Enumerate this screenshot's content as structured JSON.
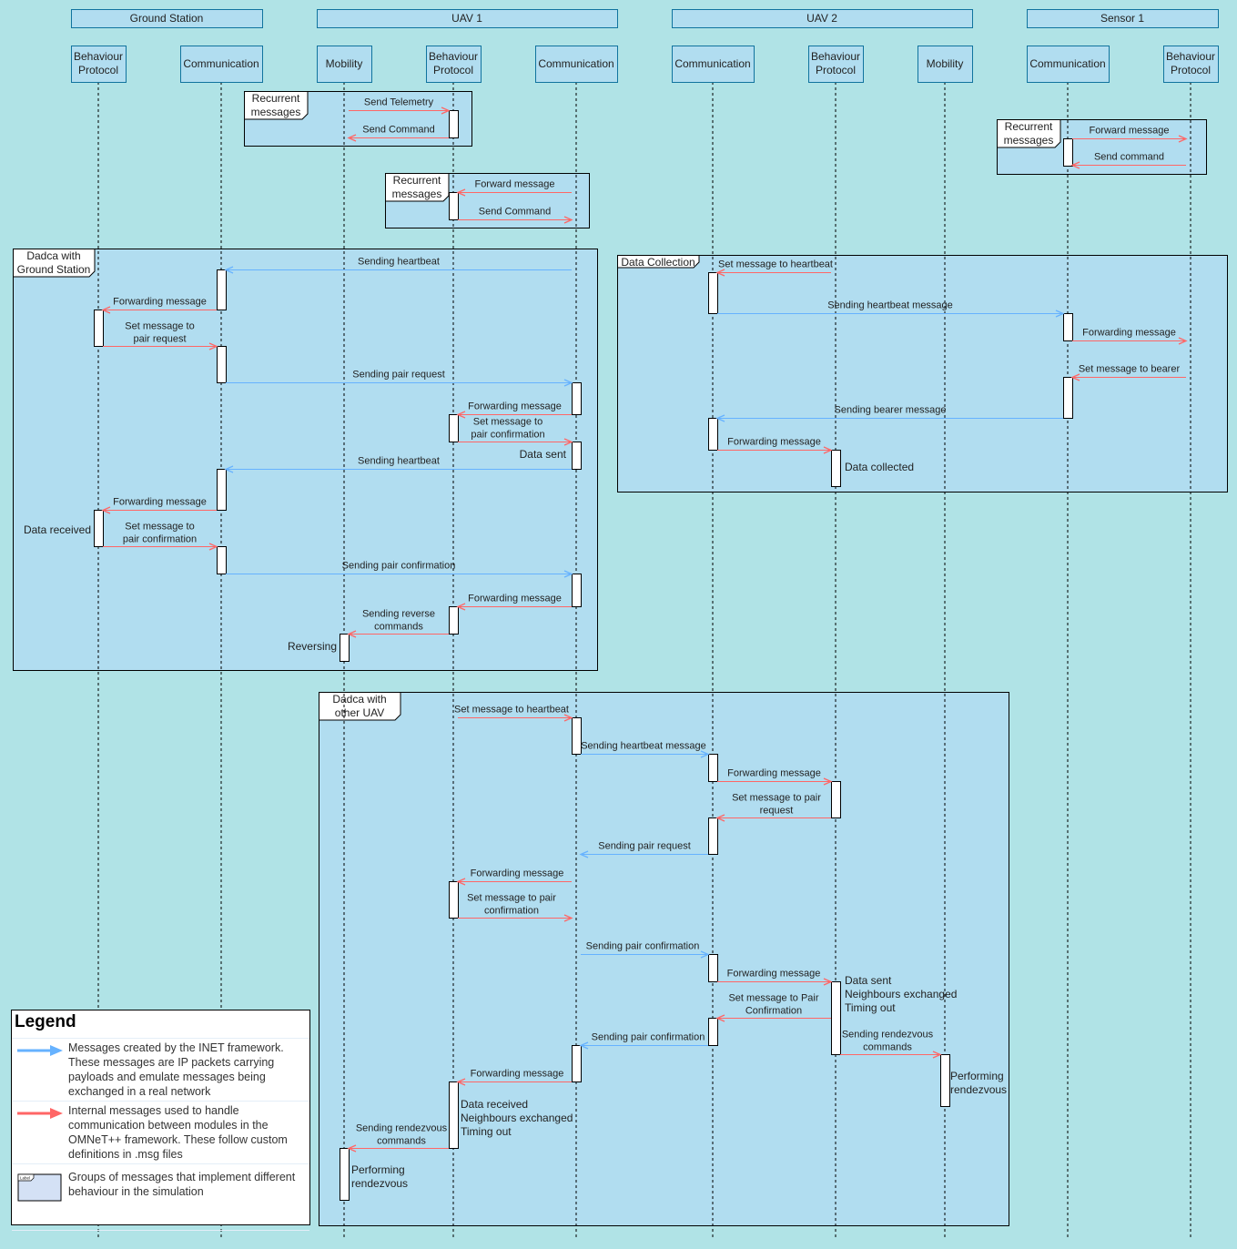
{
  "colors": {
    "background": "#b0e3e6",
    "frame": "#b1ddf0",
    "header_border": "#10739e",
    "internal_message": "#ff6666",
    "inet_message": "#66b2ff"
  },
  "groups": [
    {
      "id": "gs",
      "label": "Ground Station"
    },
    {
      "id": "uav1",
      "label": "UAV 1"
    },
    {
      "id": "uav2",
      "label": "UAV 2"
    },
    {
      "id": "sensor1",
      "label": "Sensor 1"
    }
  ],
  "participants": [
    {
      "id": "gs_bp",
      "label": "Behaviour\nProtocol"
    },
    {
      "id": "gs_comm",
      "label": "Communication"
    },
    {
      "id": "u1_mob",
      "label": "Mobility"
    },
    {
      "id": "u1_bp",
      "label": "Behaviour\nProtocol"
    },
    {
      "id": "u1_comm",
      "label": "Communication"
    },
    {
      "id": "u2_comm",
      "label": "Communication"
    },
    {
      "id": "u2_bp",
      "label": "Behaviour\nProtocol"
    },
    {
      "id": "u2_mob",
      "label": "Mobility"
    },
    {
      "id": "s1_comm",
      "label": "Communication"
    },
    {
      "id": "s1_bp",
      "label": "Behaviour\nProtocol"
    }
  ],
  "frames": [
    {
      "label": "Recurrent\nmessages"
    },
    {
      "label": "Recurrent\nmessages"
    },
    {
      "label": "Recurrent\nmessages"
    },
    {
      "label": "Dadca with\nGround Station"
    },
    {
      "label": "Data Collection"
    },
    {
      "label": "Dadca with\nother UAV"
    }
  ],
  "messages": [
    {
      "label": "Send Telemetry",
      "from": "u1_mob",
      "to": "u1_bp",
      "type": "internal"
    },
    {
      "label": "Send Command",
      "from": "u1_bp",
      "to": "u1_mob",
      "type": "internal"
    },
    {
      "label": "Forward message",
      "from": "u1_comm",
      "to": "u1_bp",
      "type": "internal"
    },
    {
      "label": "Send Command",
      "from": "u1_bp",
      "to": "u1_comm",
      "type": "internal"
    },
    {
      "label": "Forward message",
      "from": "s1_comm",
      "to": "s1_bp",
      "type": "internal"
    },
    {
      "label": "Send command",
      "from": "s1_bp",
      "to": "s1_comm",
      "type": "internal"
    },
    {
      "label": "Sending heartbeat",
      "from": "u1_comm",
      "to": "gs_comm",
      "type": "inet"
    },
    {
      "label": "Forwarding message",
      "from": "gs_comm",
      "to": "gs_bp",
      "type": "internal"
    },
    {
      "label": "Set message to\npair request",
      "from": "gs_bp",
      "to": "gs_comm",
      "type": "internal"
    },
    {
      "label": "Sending pair request",
      "from": "gs_comm",
      "to": "u1_comm",
      "type": "inet"
    },
    {
      "label": "Forwarding message",
      "from": "u1_comm",
      "to": "u1_bp",
      "type": "internal"
    },
    {
      "label": "Set message to\npair confirmation",
      "from": "u1_bp",
      "to": "u1_comm",
      "type": "internal"
    },
    {
      "label": "Sending heartbeat",
      "from": "u1_comm",
      "to": "gs_comm",
      "type": "inet"
    },
    {
      "label": "Forwarding message",
      "from": "gs_comm",
      "to": "gs_bp",
      "type": "internal"
    },
    {
      "label": "Set message to\npair confirmation",
      "from": "gs_bp",
      "to": "gs_comm",
      "type": "internal"
    },
    {
      "label": "Sending pair confirmation",
      "from": "gs_comm",
      "to": "u1_comm",
      "type": "inet"
    },
    {
      "label": "Forwarding message",
      "from": "u1_comm",
      "to": "u1_bp",
      "type": "internal"
    },
    {
      "label": "Sending reverse\ncommands",
      "from": "u1_bp",
      "to": "u1_mob",
      "type": "internal"
    },
    {
      "label": "Set message to heartbeat",
      "from": "u2_bp",
      "to": "u2_comm",
      "type": "internal"
    },
    {
      "label": "Sending heartbeat message",
      "from": "u2_comm",
      "to": "s1_comm",
      "type": "inet"
    },
    {
      "label": "Forwarding message",
      "from": "s1_comm",
      "to": "s1_bp",
      "type": "internal"
    },
    {
      "label": "Set message to bearer",
      "from": "s1_bp",
      "to": "s1_comm",
      "type": "internal"
    },
    {
      "label": "Sending bearer message",
      "from": "s1_comm",
      "to": "u2_comm",
      "type": "inet"
    },
    {
      "label": "Forwarding message",
      "from": "u2_comm",
      "to": "u2_bp",
      "type": "internal"
    },
    {
      "label": "Set message to heartbeat",
      "from": "u1_bp",
      "to": "u1_comm",
      "type": "internal"
    },
    {
      "label": "Sending heartbeat message",
      "from": "u1_comm",
      "to": "u2_comm",
      "type": "inet"
    },
    {
      "label": "Forwarding message",
      "from": "u2_comm",
      "to": "u2_bp",
      "type": "internal"
    },
    {
      "label": "Set message to  pair\nrequest",
      "from": "u2_bp",
      "to": "u2_comm",
      "type": "internal"
    },
    {
      "label": "Sending pair request",
      "from": "u2_comm",
      "to": "u1_comm",
      "type": "inet"
    },
    {
      "label": "Forwarding message",
      "from": "u1_comm",
      "to": "u1_bp",
      "type": "internal"
    },
    {
      "label": "Set message to pair\nconfirmation",
      "from": "u1_bp",
      "to": "u1_comm",
      "type": "internal"
    },
    {
      "label": "Sending pair confirmation",
      "from": "u1_comm",
      "to": "u2_comm",
      "type": "inet"
    },
    {
      "label": "Forwarding message",
      "from": "u2_comm",
      "to": "u2_bp",
      "type": "internal"
    },
    {
      "label": "Set message to Pair\nConfirmation",
      "from": "u2_bp",
      "to": "u2_comm",
      "type": "internal"
    },
    {
      "label": "Sending pair confirmation",
      "from": "u2_comm",
      "to": "u1_comm",
      "type": "inet"
    },
    {
      "label": "Sending rendezvous\ncommands",
      "from": "u2_bp",
      "to": "u2_mob",
      "type": "internal"
    },
    {
      "label": "Forwarding message",
      "from": "u1_comm",
      "to": "u1_bp",
      "type": "internal"
    },
    {
      "label": "Sending rendezvous\ncommands",
      "from": "u1_bp",
      "to": "u1_mob",
      "type": "internal"
    }
  ],
  "notes": [
    {
      "text": "Data sent"
    },
    {
      "text": "Data received"
    },
    {
      "text": "Reversing"
    },
    {
      "text": "Data collected"
    },
    {
      "text": "Data sent\nNeighbours exchanged\nTiming out"
    },
    {
      "text": "Performing\nrendezvous"
    },
    {
      "text": "Data received\nNeighbours exchanged\nTiming out"
    },
    {
      "text": "Performing\nrendezvous"
    }
  ],
  "legend": {
    "title": "Legend",
    "items": [
      {
        "icon": "blue-arrow",
        "text": "Messages created by the INET framework. These messages are IP packets carrying payloads and emulate messages being exchanged in a real network"
      },
      {
        "icon": "red-arrow",
        "text": "Internal messages used to handle communication between modules in the OMNeT++ framework. These follow custom definitions in .msg files"
      },
      {
        "icon": "group-frame",
        "text": "Groups of messages that implement different behaviour in the simulation",
        "icon_label": "Label"
      }
    ]
  }
}
